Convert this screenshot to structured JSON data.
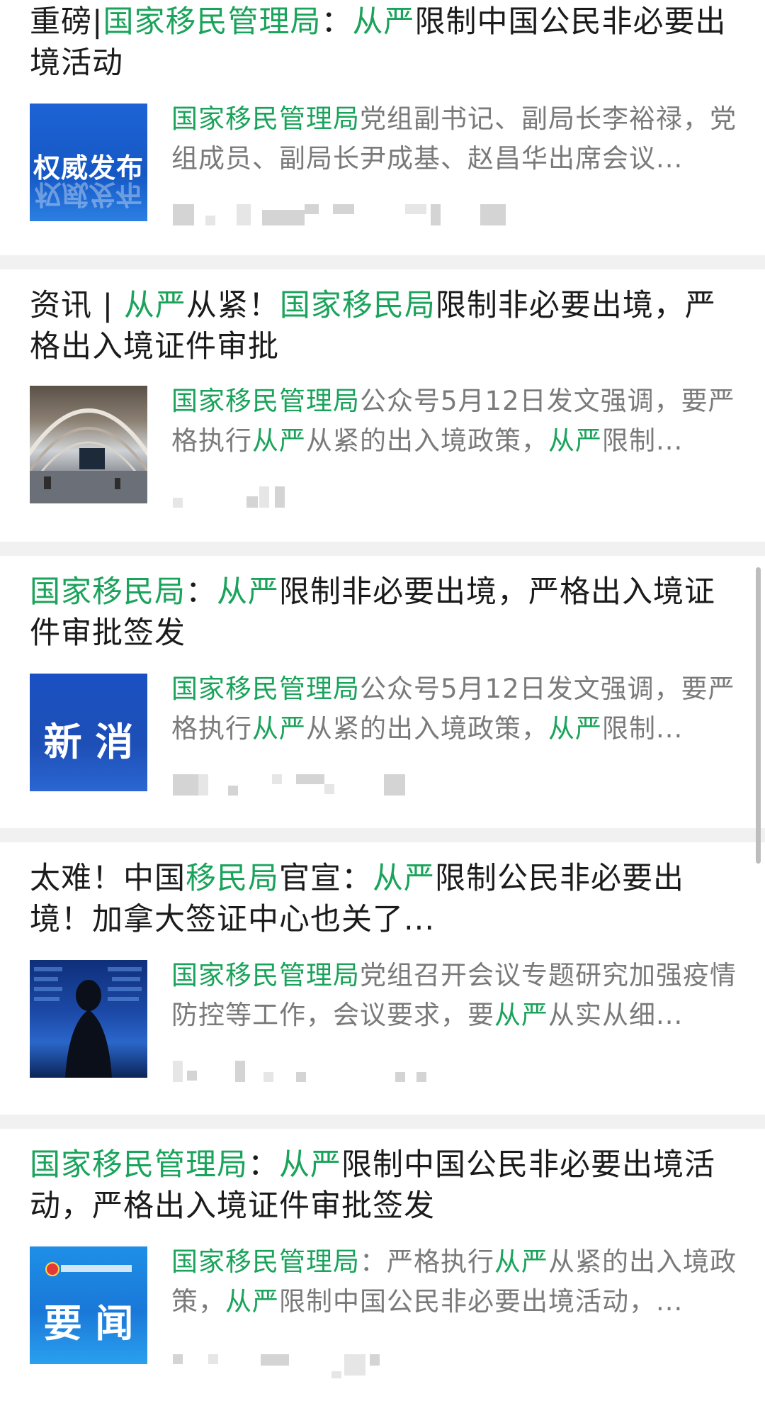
{
  "results": [
    {
      "title": [
        {
          "t": "重磅|"
        },
        {
          "t": "国家移民管理局",
          "hl": true
        },
        {
          "t": "："
        },
        {
          "t": "从严",
          "hl": true
        },
        {
          "t": "限制中国公民非必要出境活动"
        }
      ],
      "thumb_text": "权威发布",
      "thumb_icon": "official-release-thumbnail",
      "snippet": [
        {
          "t": "国家移民管理局",
          "hl": true
        },
        {
          "t": "党组副书记、副局长李裕禄，党组成员、副局长尹成基、赵昌华出席会议..."
        }
      ]
    },
    {
      "title": [
        {
          "t": "资讯 | "
        },
        {
          "t": "从严",
          "hl": true
        },
        {
          "t": "从紧！"
        },
        {
          "t": "国家移民局",
          "hl": true
        },
        {
          "t": "限制非必要出境，严格出入境证件审批"
        }
      ],
      "thumb_text": "",
      "thumb_icon": "airport-hall-photo",
      "snippet": [
        {
          "t": "国家移民管理局",
          "hl": true
        },
        {
          "t": "公众号5月12日发文强调，要严格执行"
        },
        {
          "t": "从严",
          "hl": true
        },
        {
          "t": "从紧的出入境政策，"
        },
        {
          "t": "从严",
          "hl": true
        },
        {
          "t": "限制..."
        }
      ]
    },
    {
      "title": [
        {
          "t": "国家移民局",
          "hl": true
        },
        {
          "t": "："
        },
        {
          "t": "从严",
          "hl": true
        },
        {
          "t": "限制非必要出境，严格出入境证件审批签发"
        }
      ],
      "thumb_text": "新 消",
      "thumb_icon": "news-thumbnail",
      "snippet": [
        {
          "t": "国家移民管理局",
          "hl": true
        },
        {
          "t": "公众号5月12日发文强调，要严格执行"
        },
        {
          "t": "从严",
          "hl": true
        },
        {
          "t": "从紧的出入境政策，"
        },
        {
          "t": "从严",
          "hl": true
        },
        {
          "t": "限制..."
        }
      ]
    },
    {
      "title": [
        {
          "t": "太难！中国"
        },
        {
          "t": "移民局",
          "hl": true
        },
        {
          "t": "官宣："
        },
        {
          "t": "从严",
          "hl": true
        },
        {
          "t": "限制公民非必要出境！加拿大签证中心也关了..."
        }
      ],
      "thumb_text": "",
      "thumb_icon": "departure-board-photo",
      "snippet": [
        {
          "t": "国家移民管理局",
          "hl": true
        },
        {
          "t": "党组召开会议专题研究加强疫情防控等工作，会议要求，要"
        },
        {
          "t": "从严",
          "hl": true
        },
        {
          "t": "从实从细..."
        }
      ]
    },
    {
      "title": [
        {
          "t": "国家移民管理局",
          "hl": true
        },
        {
          "t": "："
        },
        {
          "t": "从严",
          "hl": true
        },
        {
          "t": "限制中国公民非必要出境活动，严格出入境证件审批签发"
        }
      ],
      "thumb_text": "要 闻",
      "thumb_icon": "headline-news-thumbnail",
      "snippet": [
        {
          "t": "国家移民管理局",
          "hl": true
        },
        {
          "t": "：严格执行"
        },
        {
          "t": "从严",
          "hl": true
        },
        {
          "t": "从紧的出入境政策，"
        },
        {
          "t": "从严",
          "hl": true
        },
        {
          "t": "限制中国公民非必要出境活动，..."
        }
      ]
    }
  ],
  "colors": {
    "highlight": "#1aa35a",
    "title_text": "#1b1b1b",
    "snippet_text": "#7a7a7a",
    "separator": "#f1f1f1"
  }
}
